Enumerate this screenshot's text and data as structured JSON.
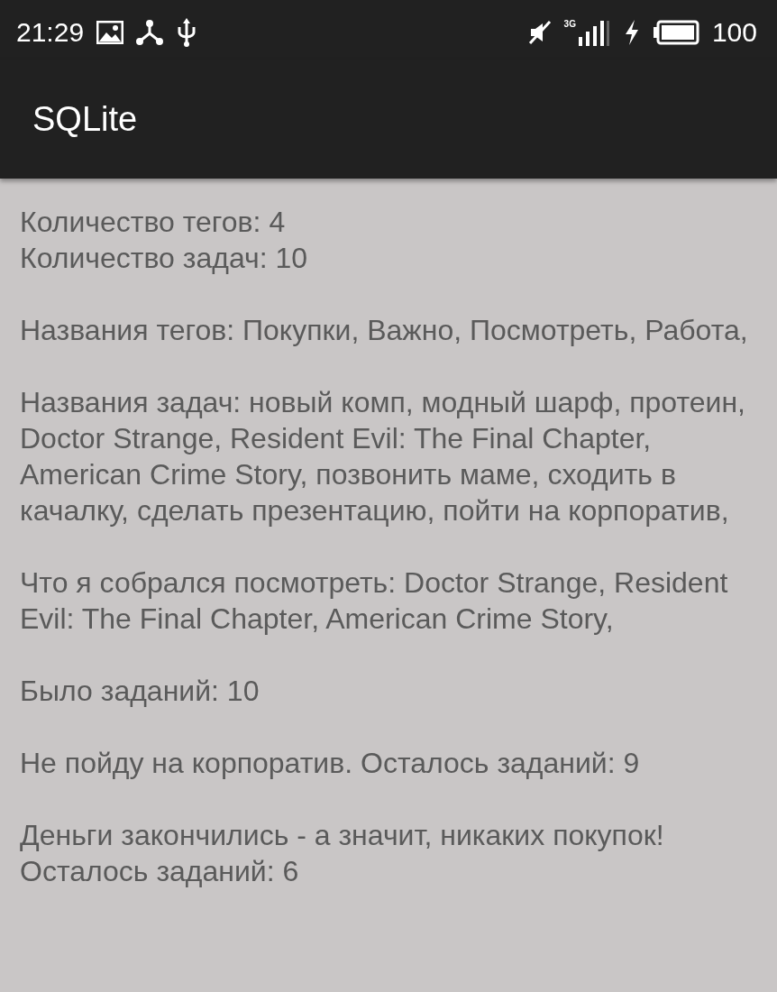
{
  "status_bar": {
    "time": "21:29",
    "network": "3G",
    "battery": "100"
  },
  "app_bar": {
    "title": "SQLite"
  },
  "paragraphs": [
    [
      "Количество тегов: 4",
      "Количество задач: 10"
    ],
    [
      "Названия тегов: Покупки, Важно, Посмотреть, Работа,"
    ],
    [
      "Названия задач: новый комп, модный шарф, протеин, Doctor Strange, Resident Evil: The Final Chapter, American Crime Story, позвонить маме, сходить в качалку, сделать презентацию, пойти на корпоратив,"
    ],
    [
      "Что я собрался посмотреть: Doctor Strange, Resident Evil: The Final Chapter, American Crime Story,"
    ],
    [
      "Было заданий: 10"
    ],
    [
      "Не пойду на корпоратив. Осталось заданий: 9"
    ],
    [
      "Деньги закончились - а значит, никаких покупок!",
      "Осталось заданий: 6"
    ]
  ]
}
